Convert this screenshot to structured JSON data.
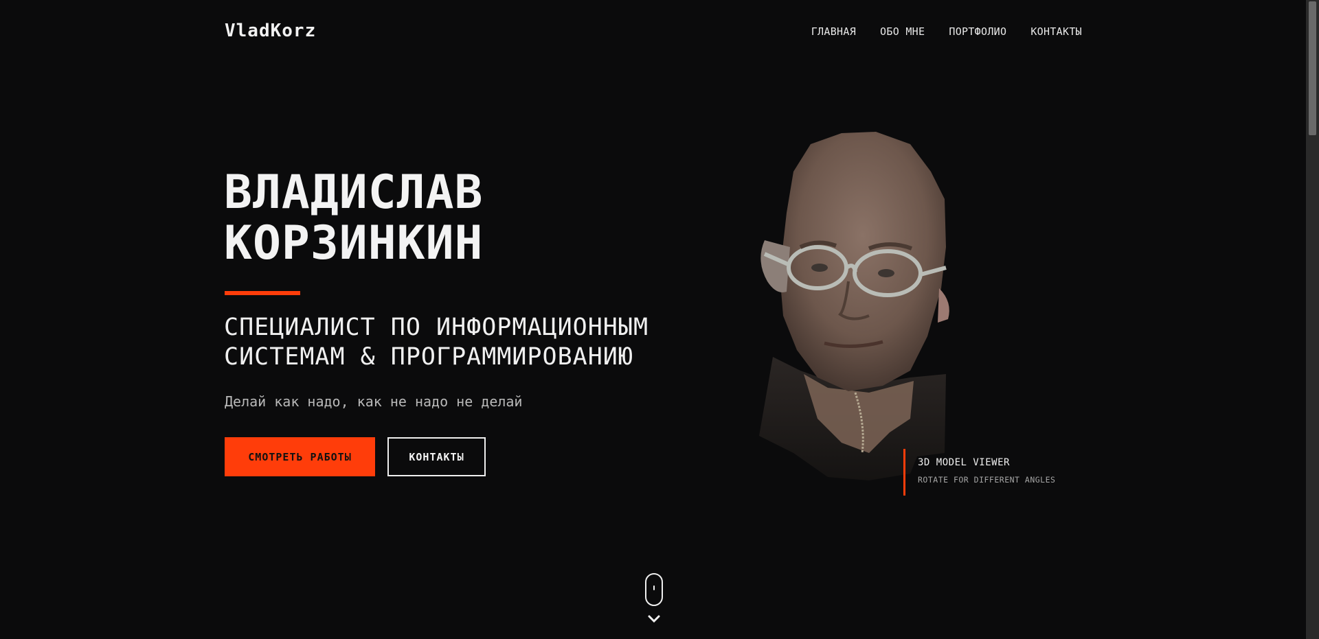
{
  "header": {
    "logo": "VladKorz",
    "nav": [
      {
        "label": "ГЛАВНАЯ"
      },
      {
        "label": "ОБО МНЕ"
      },
      {
        "label": "ПОРТФОЛИО"
      },
      {
        "label": "КОНТАКТЫ"
      }
    ]
  },
  "hero": {
    "name_line1": "ВЛАДИСЛАВ",
    "name_line2": "КОРЗИНКИН",
    "subtitle_line1": "СПЕЦИАЛИСТ ПО ИНФОРМАЦИОННЫМ",
    "subtitle_line2": "СИСТЕМАМ & ПРОГРАММИРОВАНИЮ",
    "tagline": "Делай как надо, как не надо не делай",
    "primary_button": "СМОТРЕТЬ РАБОТЫ",
    "secondary_button": "КОНТАКТЫ"
  },
  "model_viewer": {
    "title": "3D MODEL VIEWER",
    "subtitle": "ROTATE FOR DIFFERENT ANGLES"
  },
  "icons": {
    "scroll_indicator": "mouse-icon",
    "scroll_arrow": "chevron-down-icon"
  },
  "colors": {
    "background": "#0b0b0c",
    "accent": "#ff3d0a",
    "text": "#f0f0f0",
    "muted": "#b9b9b9"
  }
}
